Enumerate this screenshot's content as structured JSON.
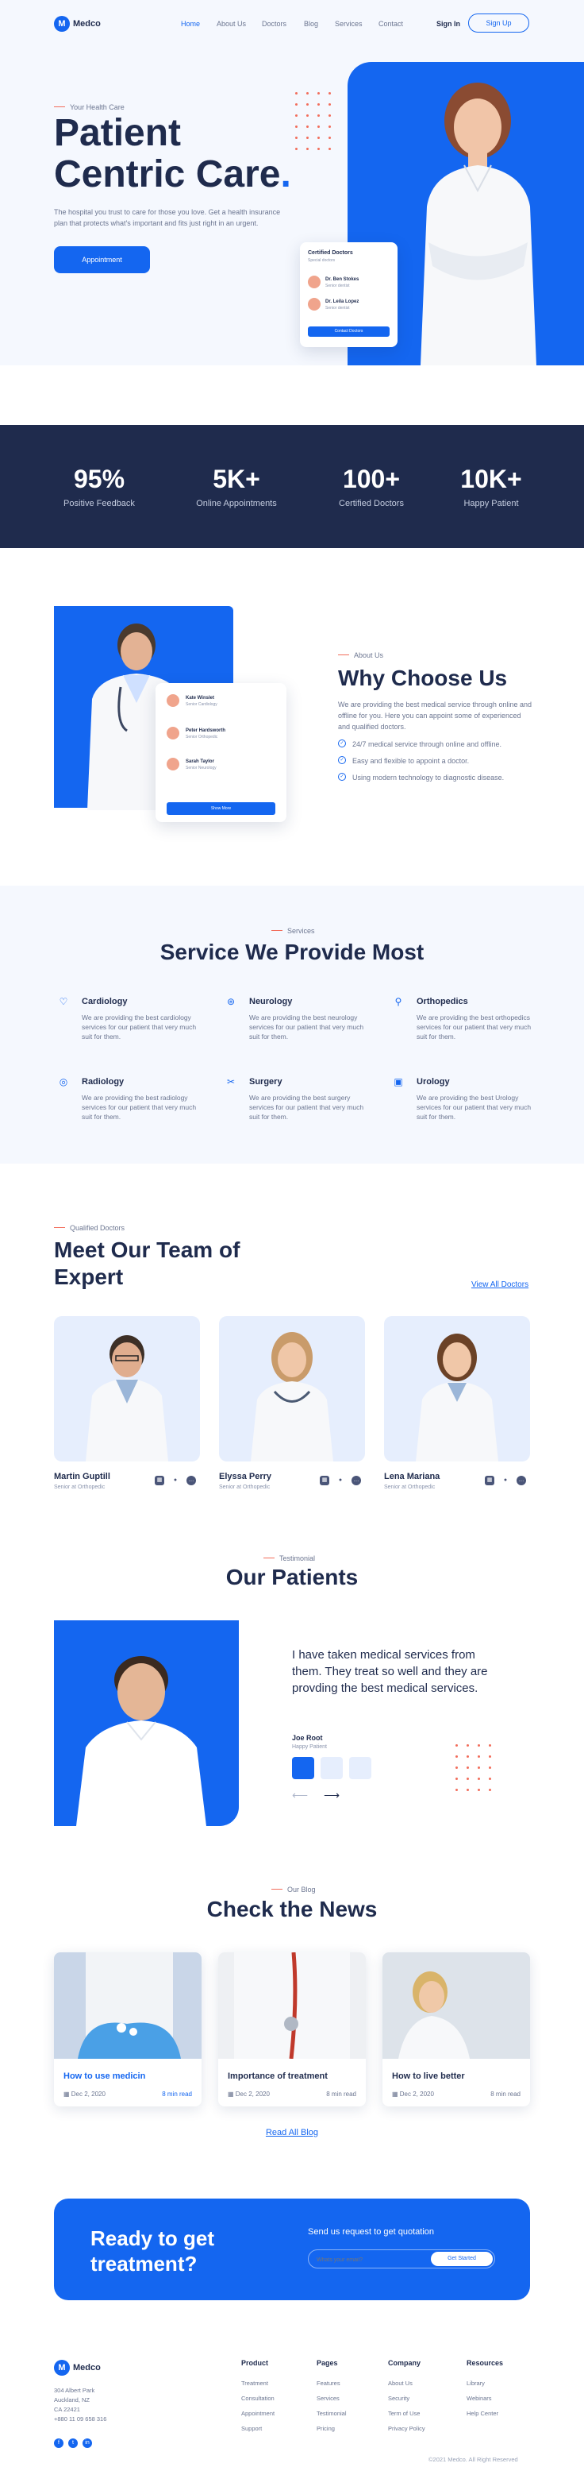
{
  "brand": {
    "name": "Medco",
    "logo_letter": "M",
    "accent": "#1466f0",
    "dark": "#1f2b4d",
    "coral": "#f26d5b"
  },
  "nav": {
    "links": [
      "Home",
      "About Us",
      "Doctors",
      "Blog",
      "Services",
      "Contact"
    ],
    "active": "Home",
    "signin": "Sign In",
    "signup": "Sign Up"
  },
  "hero": {
    "eyebrow": "Your Health Care",
    "title_line1": "Patient",
    "title_line2": "Centric Care",
    "title_dot": ".",
    "description": "The hospital you trust to care for those you love. Get a health insurance plan that protects what's important and fits just right in an urgent.",
    "cta": "Appointment",
    "card": {
      "title": "Certified Doctors",
      "subtitle": "Special doctors",
      "doctors": [
        {
          "name": "Dr. Ben Stokes",
          "role": "Senior dentist"
        },
        {
          "name": "Dr. Leila Lopez",
          "role": "Senior dentist"
        }
      ],
      "button": "Contact Doctors"
    }
  },
  "stats": [
    {
      "value": "95%",
      "label": "Positive Feedback"
    },
    {
      "value": "5K+",
      "label": "Online Appointments"
    },
    {
      "value": "100+",
      "label": "Certified Doctors"
    },
    {
      "value": "10K+",
      "label": "Happy Patient"
    }
  ],
  "why": {
    "eyebrow": "About Us",
    "title": "Why Choose Us",
    "description": "We are providing the best medical service through online and offline for you. Here you can appoint some of experienced and qualified doctors.",
    "points": [
      "24/7 medical service through online and offline.",
      "Easy and flexible to appoint a doctor.",
      "Using modern technology to diagnostic disease."
    ],
    "card": {
      "doctors": [
        {
          "name": "Kate Winslet",
          "role": "Senior Cardiology"
        },
        {
          "name": "Peter Hardsworth",
          "role": "Senior Orthopedic"
        },
        {
          "name": "Sarah Taylor",
          "role": "Senior Neurology"
        }
      ],
      "button": "Show More"
    }
  },
  "services": {
    "eyebrow": "Services",
    "title": "Service We Provide Most",
    "items": [
      {
        "icon": "heart-icon",
        "name": "Cardiology",
        "desc": "We are providing the best cardiology services for our patient that very much suit for them."
      },
      {
        "icon": "brain-icon",
        "name": "Neurology",
        "desc": "We are providing the best neurology services for our patient that very much suit for them."
      },
      {
        "icon": "bone-icon",
        "name": "Orthopedics",
        "desc": "We are providing the best orthopedics services for our patient that very much suit for them."
      },
      {
        "icon": "radiation-icon",
        "name": "Radiology",
        "desc": "We are providing the best radiology services for our patient that very much suit for them."
      },
      {
        "icon": "scalpel-icon",
        "name": "Surgery",
        "desc": "We are providing the best surgery services for our patient that very much suit for them."
      },
      {
        "icon": "kidney-icon",
        "name": "Urology",
        "desc": "We are providing the best Urology services for our patient that very much suit for them."
      }
    ]
  },
  "team": {
    "eyebrow": "Qualified Doctors",
    "title_line1": "Meet Our Team of",
    "title_line2": "Expert",
    "view_all": "View All Doctors",
    "members": [
      {
        "name": "Martin Guptill",
        "role": "Senior at Orthopedic"
      },
      {
        "name": "Elyssa Perry",
        "role": "Senior at Orthopedic"
      },
      {
        "name": "Lena Mariana",
        "role": "Senior at Orthopedic"
      }
    ]
  },
  "testimonial": {
    "eyebrow": "Testimonial",
    "title": "Our Patients",
    "quote": "I have taken medical services from them. They treat so well and they are provding the best medical services.",
    "author": "Joe Root",
    "author_role": "Happy Patient"
  },
  "blog": {
    "eyebrow": "Our Blog",
    "title": "Check the News",
    "posts": [
      {
        "title": "How to use medicin",
        "date": "Dec 2, 2020",
        "read": "8 min read",
        "highlight": true
      },
      {
        "title": "Importance of treatment",
        "date": "Dec 2, 2020",
        "read": "8 min read",
        "highlight": false
      },
      {
        "title": "How to live better",
        "date": "Dec 2, 2020",
        "read": "8 min read",
        "highlight": false
      }
    ],
    "read_all": "Read All Blog"
  },
  "cta": {
    "title_line1": "Ready to get",
    "title_line2": "treatment?",
    "label": "Send us request to get quotation",
    "placeholder": "Whats your email?",
    "button": "Get Started"
  },
  "footer": {
    "brand": "Medco",
    "address": [
      "304 Albert Park",
      "Auckland, NZ",
      "CA 22421",
      "+880 11 09 658 316"
    ],
    "columns": [
      {
        "head": "Product",
        "links": [
          "Treatment",
          "Consultation",
          "Appointment",
          "Support"
        ]
      },
      {
        "head": "Pages",
        "links": [
          "Features",
          "Services",
          "Testimonial",
          "Pricing"
        ]
      },
      {
        "head": "Company",
        "links": [
          "About Us",
          "Security",
          "Term of Use",
          "Privacy Policy"
        ]
      },
      {
        "head": "Resources",
        "links": [
          "Library",
          "Webinars",
          "Help Center"
        ]
      }
    ],
    "copyright": "©2021 Medco. All Right Reserved"
  }
}
